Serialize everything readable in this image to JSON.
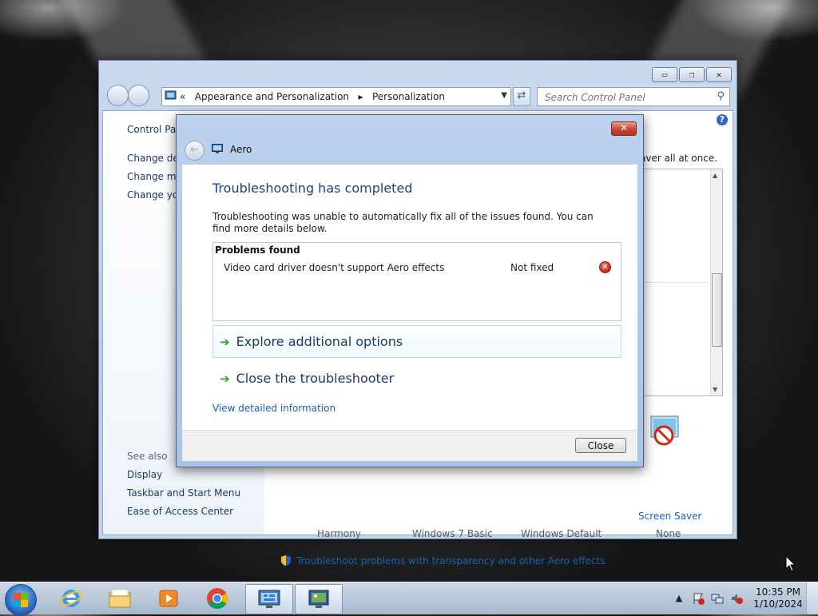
{
  "control_panel": {
    "breadcrumb": {
      "prefix": "«",
      "item1": "Appearance and Personalization",
      "sep": "▸",
      "item2": "Personalization"
    },
    "search_placeholder": "Search Control Panel",
    "left_pane": {
      "home": "Control Pan",
      "links": [
        "Change des",
        "Change mo",
        "Change you"
      ],
      "see_also_header": "See also",
      "see_also": [
        "Display",
        "Taskbar and Start Menu",
        "Ease of Access Center"
      ]
    },
    "right_text": "aver all at once.",
    "themes": [
      "Harmony",
      "Windows 7 Basic",
      "Windows Default"
    ],
    "screen_saver": {
      "label": "Screen Saver",
      "value": "None"
    },
    "troubleshoot_link": "Troubleshoot problems with transparency and other Aero effects"
  },
  "dialog": {
    "title": "Aero",
    "heading": "Troubleshooting has completed",
    "message": "Troubleshooting was unable to automatically fix all of the issues found. You can find more details below.",
    "problems_header": "Problems found",
    "problems": [
      {
        "name": "Video card driver doesn't support Aero effects",
        "status": "Not fixed"
      }
    ],
    "options": [
      "Explore additional options",
      "Close the troubleshooter"
    ],
    "detail_link": "View detailed information",
    "close_button": "Close"
  },
  "taskbar": {
    "clock_time": "10:35 PM",
    "clock_date": "1/10/2024",
    "items": [
      "internet-explorer-icon",
      "file-explorer-icon",
      "media-player-icon",
      "chrome-icon",
      "control-panel-icon",
      "personalization-icon"
    ]
  },
  "colors": {
    "link": "#1a5fb4",
    "heading": "#1d3f8b",
    "accent_green": "#2e9c2e",
    "error_red": "#c5251b"
  }
}
